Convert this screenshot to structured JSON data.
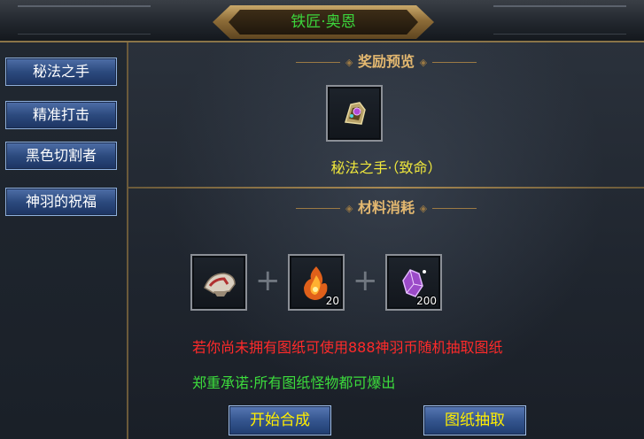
{
  "window": {
    "title": "铁匠·奥恩"
  },
  "sidebar": {
    "items": [
      {
        "label": "秘法之手"
      },
      {
        "label": "精准打击"
      },
      {
        "label": "黑色切割者"
      },
      {
        "label": "神羽的祝福"
      }
    ]
  },
  "reward": {
    "header": "奖励预览",
    "item_icon": "gem-glove-icon",
    "item_name": "秘法之手·（致命）"
  },
  "materials": {
    "header": "材料消耗",
    "slots": [
      {
        "icon": "pauldron-icon",
        "count": ""
      },
      {
        "icon": "flame-crystal-icon",
        "count": "20"
      },
      {
        "icon": "purple-crystal-icon",
        "count": "200"
      }
    ]
  },
  "messages": {
    "warning": "若你尚未拥有图纸可使用888神羽币随机抽取图纸",
    "notice": "郑重承诺:所有图纸怪物都可爆出"
  },
  "actions": {
    "start_label": "开始合成",
    "draw_label": "图纸抽取"
  },
  "colors": {
    "title_text": "#3cd43c",
    "reward_name": "#f0e83c",
    "warning": "#ff2a2a",
    "notice": "#3cdc3c",
    "action_text": "#ffee00",
    "header_gold": "#e3b870"
  }
}
